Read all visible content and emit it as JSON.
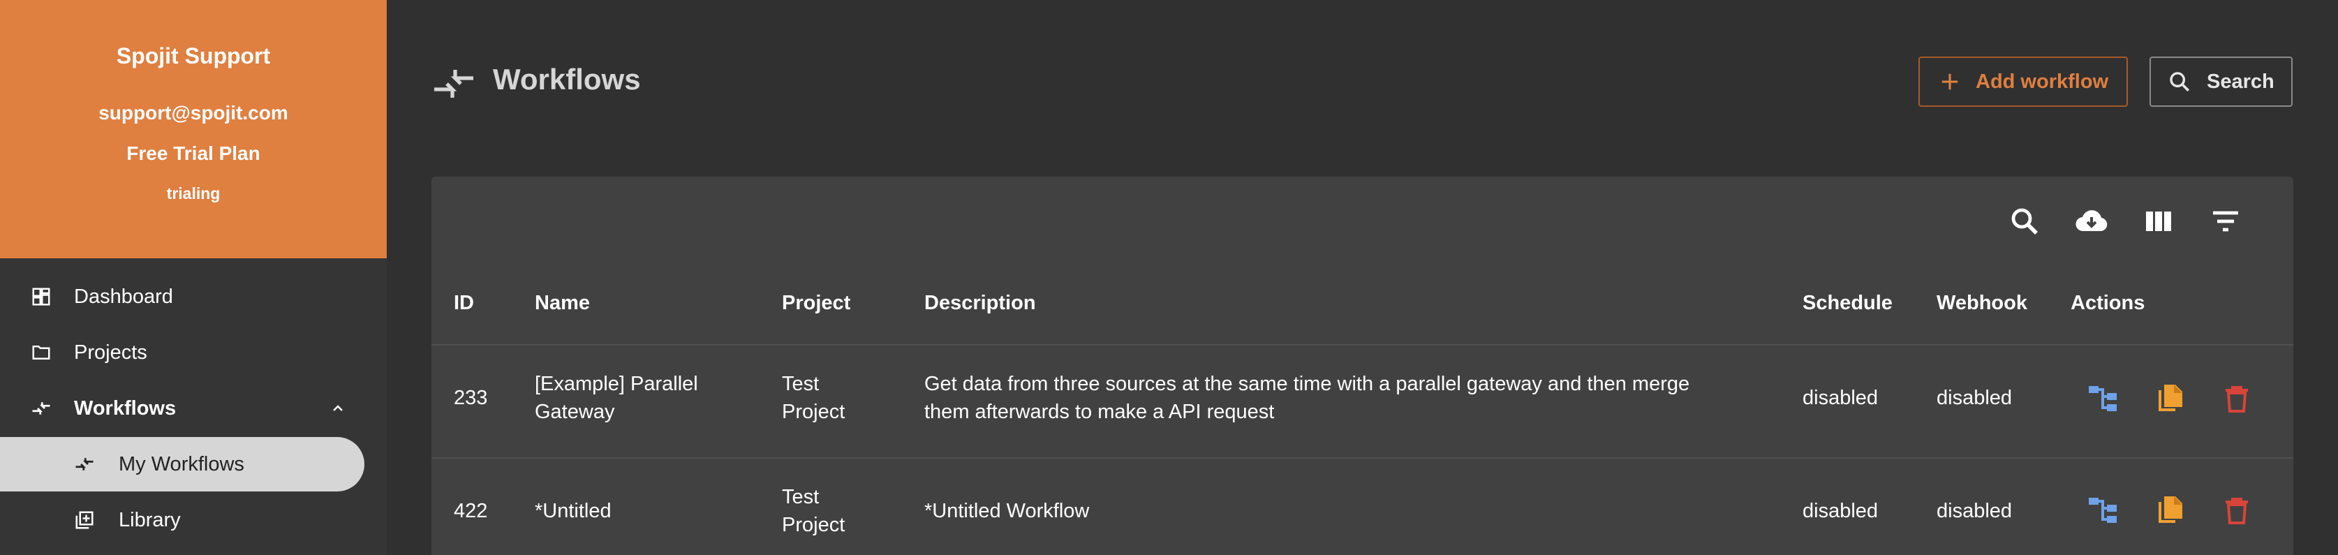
{
  "account": {
    "company": "Spojit Support",
    "email": "support@spojit.com",
    "plan": "Free Trial Plan",
    "status": "trialing"
  },
  "sidebar": {
    "items": [
      {
        "label": "Dashboard",
        "icon": "dashboard-icon"
      },
      {
        "label": "Projects",
        "icon": "folder-icon"
      },
      {
        "label": "Workflows",
        "icon": "workflow-icon",
        "expanded": true
      }
    ],
    "subitems": [
      {
        "label": "My Workflows",
        "icon": "workflow-icon",
        "active": true
      },
      {
        "label": "Library",
        "icon": "library-icon"
      }
    ]
  },
  "header": {
    "title": "Workflows",
    "add_label": "Add workflow",
    "search_label": "Search"
  },
  "table": {
    "columns": [
      "ID",
      "Name",
      "Project",
      "Description",
      "Schedule",
      "Webhook",
      "Actions"
    ],
    "rows": [
      {
        "id": "233",
        "name": [
          "[Example] Parallel",
          "Gateway"
        ],
        "project": [
          "Test",
          "Project"
        ],
        "description": [
          "Get data from three sources at the same time with a parallel gateway and then merge",
          "them afterwards to make a API request"
        ],
        "schedule": "disabled",
        "webhook": "disabled"
      },
      {
        "id": "422",
        "name": [
          "*Untitled"
        ],
        "project": [
          "Test",
          "Project"
        ],
        "description": [
          "*Untitled Workflow"
        ],
        "schedule": "disabled",
        "webhook": "disabled"
      }
    ]
  },
  "colors": {
    "accent": "#DF7F40",
    "background": "#303030",
    "sidebar": "#353535",
    "panel": "#414141",
    "flow_icon": "#6FA2E8",
    "copy_icon": "#F0A030",
    "delete_icon": "#D9443A"
  }
}
